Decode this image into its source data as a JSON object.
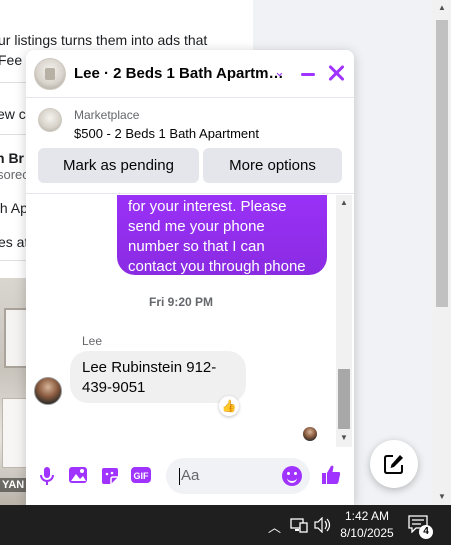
{
  "background": {
    "lines": [
      "ur listings turns them into ads that",
      "Fee",
      "ew c",
      "n Br",
      "sorec",
      "th Ap",
      "es at"
    ],
    "photo_caption": "YAN E"
  },
  "chat": {
    "title": "Lee · 2 Beds 1 Bath Apartm…",
    "marketplace_label": "Marketplace",
    "listing_title": "$500 - 2 Beds 1 Bath Apartment",
    "mark_pending_label": "Mark as pending",
    "more_options_label": "More options",
    "outgoing_lines": [
      "for your interest. Please",
      "send me your phone",
      "number so that I can",
      "contact you through phone"
    ],
    "timestamp": "Fri 9:20 PM",
    "sender_name": "Lee",
    "incoming_lines": [
      "Lee Rubinstein 912-",
      "439-9051"
    ],
    "reaction": "👍",
    "composer_placeholder": "Aa"
  },
  "taskbar": {
    "time": "1:42 AM",
    "date": "8/10/2025",
    "notification_count": "4"
  },
  "colors": {
    "accent": "#a033ff",
    "bubble_gray": "#f0f0f0",
    "taskbar": "#1f1f1f"
  },
  "icons": [
    "chevron-down-icon",
    "minimize-icon",
    "close-icon",
    "mic-icon",
    "photo-icon",
    "sticker-icon",
    "gif-icon",
    "emoji-icon",
    "like-icon",
    "compose-icon",
    "chevron-up-icon",
    "wifi-icon",
    "speaker-icon",
    "notification-icon"
  ]
}
